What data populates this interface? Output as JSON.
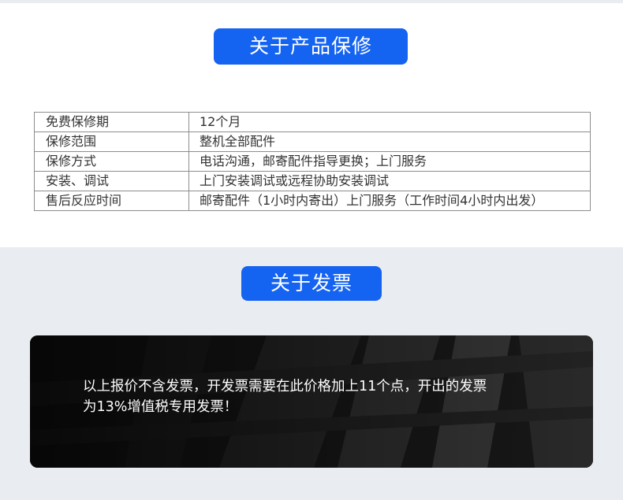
{
  "warranty": {
    "title": "关于产品保修",
    "rows": [
      {
        "label": "免费保修期",
        "value": "12个月"
      },
      {
        "label": "保修范围",
        "value": "整机全部配件"
      },
      {
        "label": "保修方式",
        "value": "电话沟通，邮寄配件指导更换；上门服务"
      },
      {
        "label": "安装、调试",
        "value": "上门安装调试或远程协助安装调试"
      },
      {
        "label": "售后反应时间",
        "value": "邮寄配件（1小时内寄出）上门服务（工作时间4小时内出发）"
      }
    ]
  },
  "invoice": {
    "title": "关于发票",
    "line1": "以上报价不含发票，开发票需要在此价格加上11个点，开出的发票",
    "line2": "为13%增值税专用发票！"
  },
  "colors": {
    "accent": "#1463f1",
    "page_bg": "#e9ecf1",
    "card_bg": "#101010"
  }
}
